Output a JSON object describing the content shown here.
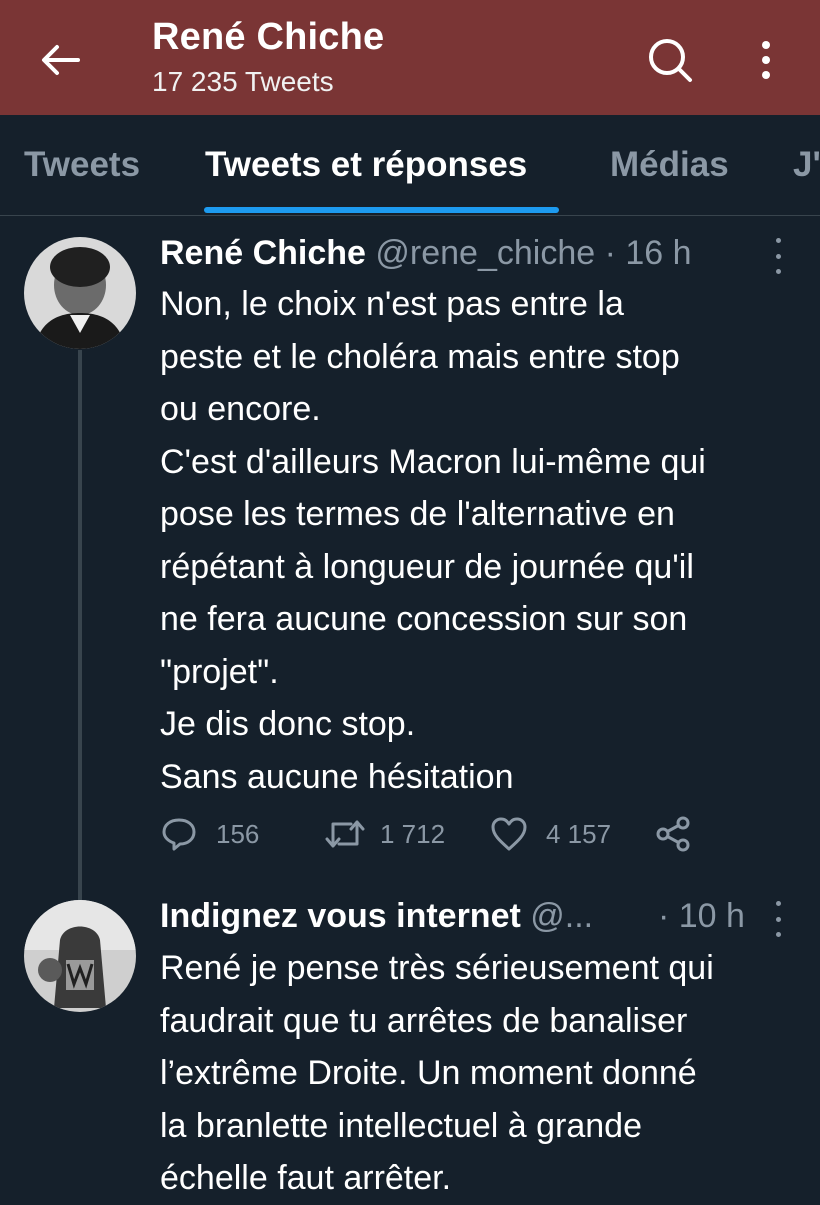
{
  "header": {
    "title": "René Chiche",
    "subtitle": "17 235 Tweets",
    "color": "#7a3535"
  },
  "tabs": [
    {
      "label": "Tweets",
      "active": false
    },
    {
      "label": "Tweets et réponses",
      "active": true
    },
    {
      "label": "Médias",
      "active": false
    },
    {
      "label": "J'",
      "active": false
    }
  ],
  "accent": "#1d9bf0",
  "tweets": [
    {
      "name": "René Chiche",
      "handle": "@rene_chiche",
      "time": "· 16 h",
      "text": "Non, le choix n'est pas entre la\npeste et le choléra mais entre stop\nou encore.\nC'est d'ailleurs Macron lui-même qui\npose les termes de l'alternative en\nrépétant à longueur de journée qu'il\nne fera aucune concession sur son\n\"projet\".\nJe dis donc stop.\nSans aucune hésitation",
      "replies": "156",
      "retweets": "1 712",
      "likes": "4 157"
    },
    {
      "name": "Indignez vous internet",
      "handle": "@...",
      "time": "· 10 h",
      "text": "René je pense très sérieusement qui\nfaudrait que tu arrêtes de banaliser\nl’extrême Droite. Un moment donné\nla branlette intellectuel à grande\néchelle faut arrêter."
    }
  ]
}
